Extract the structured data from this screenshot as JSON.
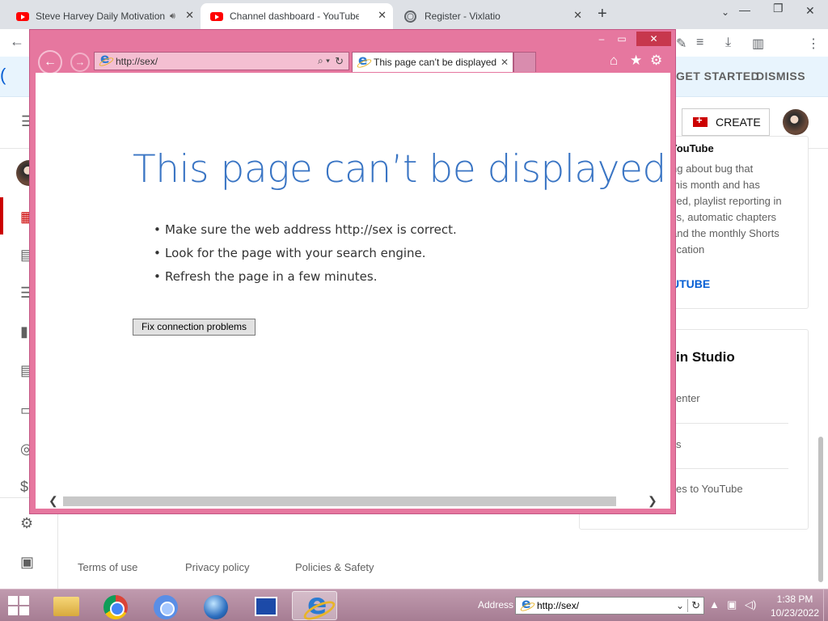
{
  "chrome": {
    "tabs": [
      {
        "title": "Steve Harvey Daily Motivation"
      },
      {
        "title": "Channel dashboard - YouTube Studio"
      },
      {
        "title": "Register - Vixlatio"
      }
    ],
    "new_tab": "+",
    "close_glyph": "✕"
  },
  "studio": {
    "banner": {
      "get_started": "GET STARTED",
      "dismiss": "DISMISS"
    },
    "create_label": "CREATE",
    "news_card": {
      "heading": "YouTube",
      "lines": [
        "ng about bug that",
        "this month and has",
        "ved, playlist reporting in",
        "cs, automatic chapters",
        "and the monthly Shorts",
        "fication"
      ],
      "link": "UTUBE"
    },
    "whats_new_card": {
      "heading": "in Studio",
      "items": [
        "enter",
        "s",
        "es to YouTube"
      ]
    },
    "footer": {
      "terms": "Terms of use",
      "privacy": "Privacy policy",
      "policies": "Policies & Safety"
    }
  },
  "ie": {
    "address": "http://sex/",
    "tab_title": "This page can’t be displayed",
    "error_title": "This page can’t be displayed",
    "bullets": [
      "Make sure the web address http://sex is correct.",
      "Look for the page with your search engine.",
      "Refresh the page in a few minutes."
    ],
    "fix_button": "Fix connection problems"
  },
  "taskbar": {
    "address_label": "Address",
    "address_value": "http://sex/",
    "time": "1:38 PM",
    "date": "10/23/2022"
  },
  "colors": {
    "ie_frame": "#e6779f",
    "error_title": "#3a75c4",
    "youtube_red": "#ff0000",
    "taskbar": "#b48aa1"
  }
}
